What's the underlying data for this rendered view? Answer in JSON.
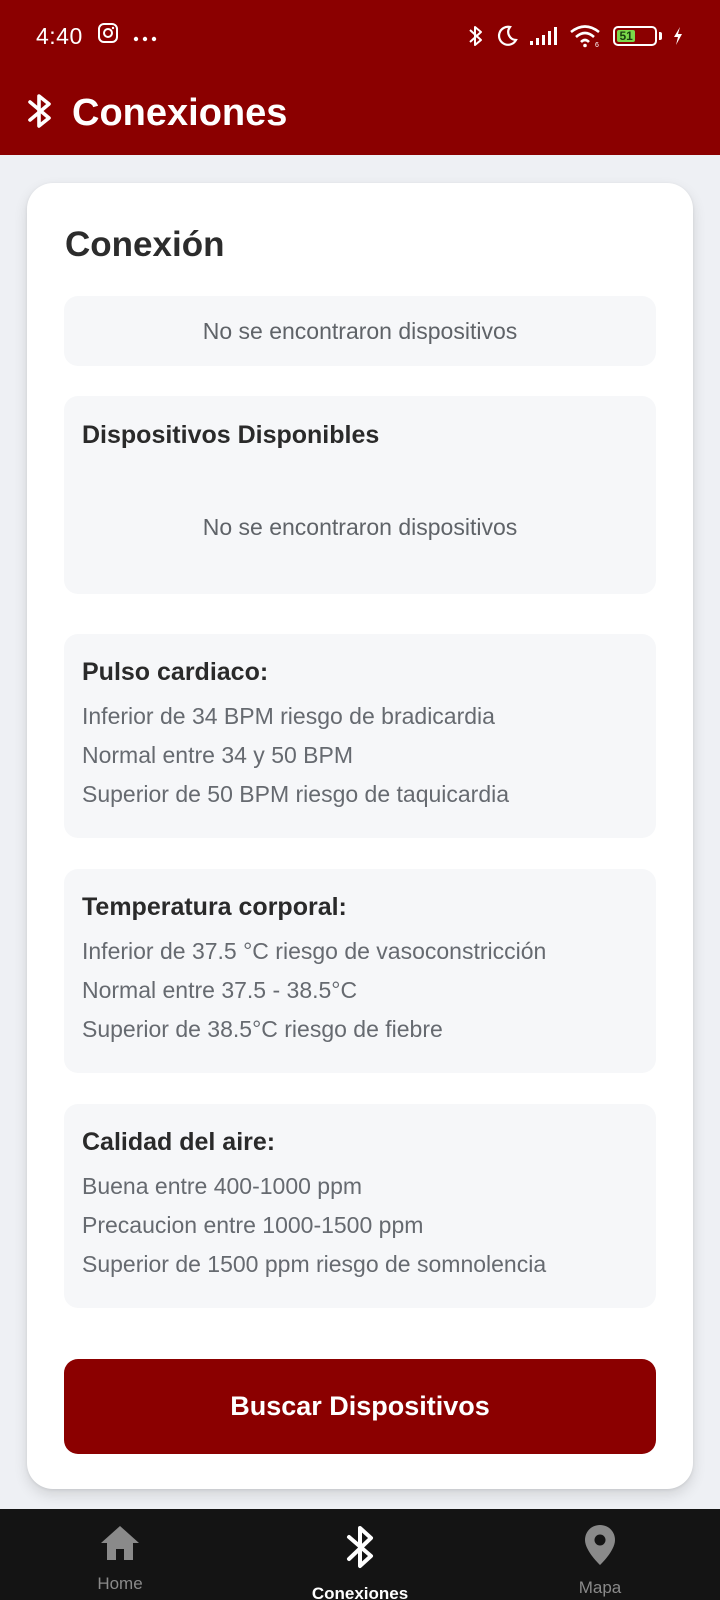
{
  "status_bar": {
    "time": "4:40",
    "battery": "51",
    "icons": [
      "instagram-icon",
      "more-dots-icon",
      "bluetooth-icon",
      "moon-icon",
      "signal-icon",
      "wifi-icon",
      "battery-icon",
      "charging-icon"
    ]
  },
  "app_bar": {
    "title": "Conexiones",
    "icon": "bluetooth-icon"
  },
  "card": {
    "title": "Conexión",
    "connection_status": "No se encontraron dispositivos",
    "available": {
      "heading": "Dispositivos Disponibles",
      "empty_text": "No se encontraron dispositivos"
    },
    "pulse": {
      "heading": "Pulso cardiaco:",
      "lines": [
        "Inferior de 34 BPM riesgo de bradicardia",
        "Normal entre 34 y 50 BPM",
        "Superior de 50 BPM riesgo de taquicardia"
      ]
    },
    "temperature": {
      "heading": "Temperatura corporal:",
      "lines": [
        "Inferior de 37.5 °C riesgo de vasoconstricción",
        "Normal entre 37.5 - 38.5°C",
        "Superior de 38.5°C riesgo de fiebre"
      ]
    },
    "air": {
      "heading": "Calidad del aire:",
      "lines": [
        "Buena entre 400-1000 ppm",
        "Precaucion entre 1000-1500 ppm",
        "Superior de 1500 ppm riesgo de somnolencia"
      ]
    },
    "search_button": "Buscar Dispositivos"
  },
  "bottom_nav": {
    "items": [
      {
        "label": "Home",
        "icon": "home-icon",
        "active": false
      },
      {
        "label": "Conexiones",
        "icon": "bluetooth-icon",
        "active": true
      },
      {
        "label": "Mapa",
        "icon": "map-pin-icon",
        "active": false
      }
    ]
  },
  "colors": {
    "primary": "#8b0000",
    "background": "#eef0f4",
    "panel": "#f6f7f9",
    "nav_background": "#141414",
    "battery_fill": "#7bd84a"
  }
}
